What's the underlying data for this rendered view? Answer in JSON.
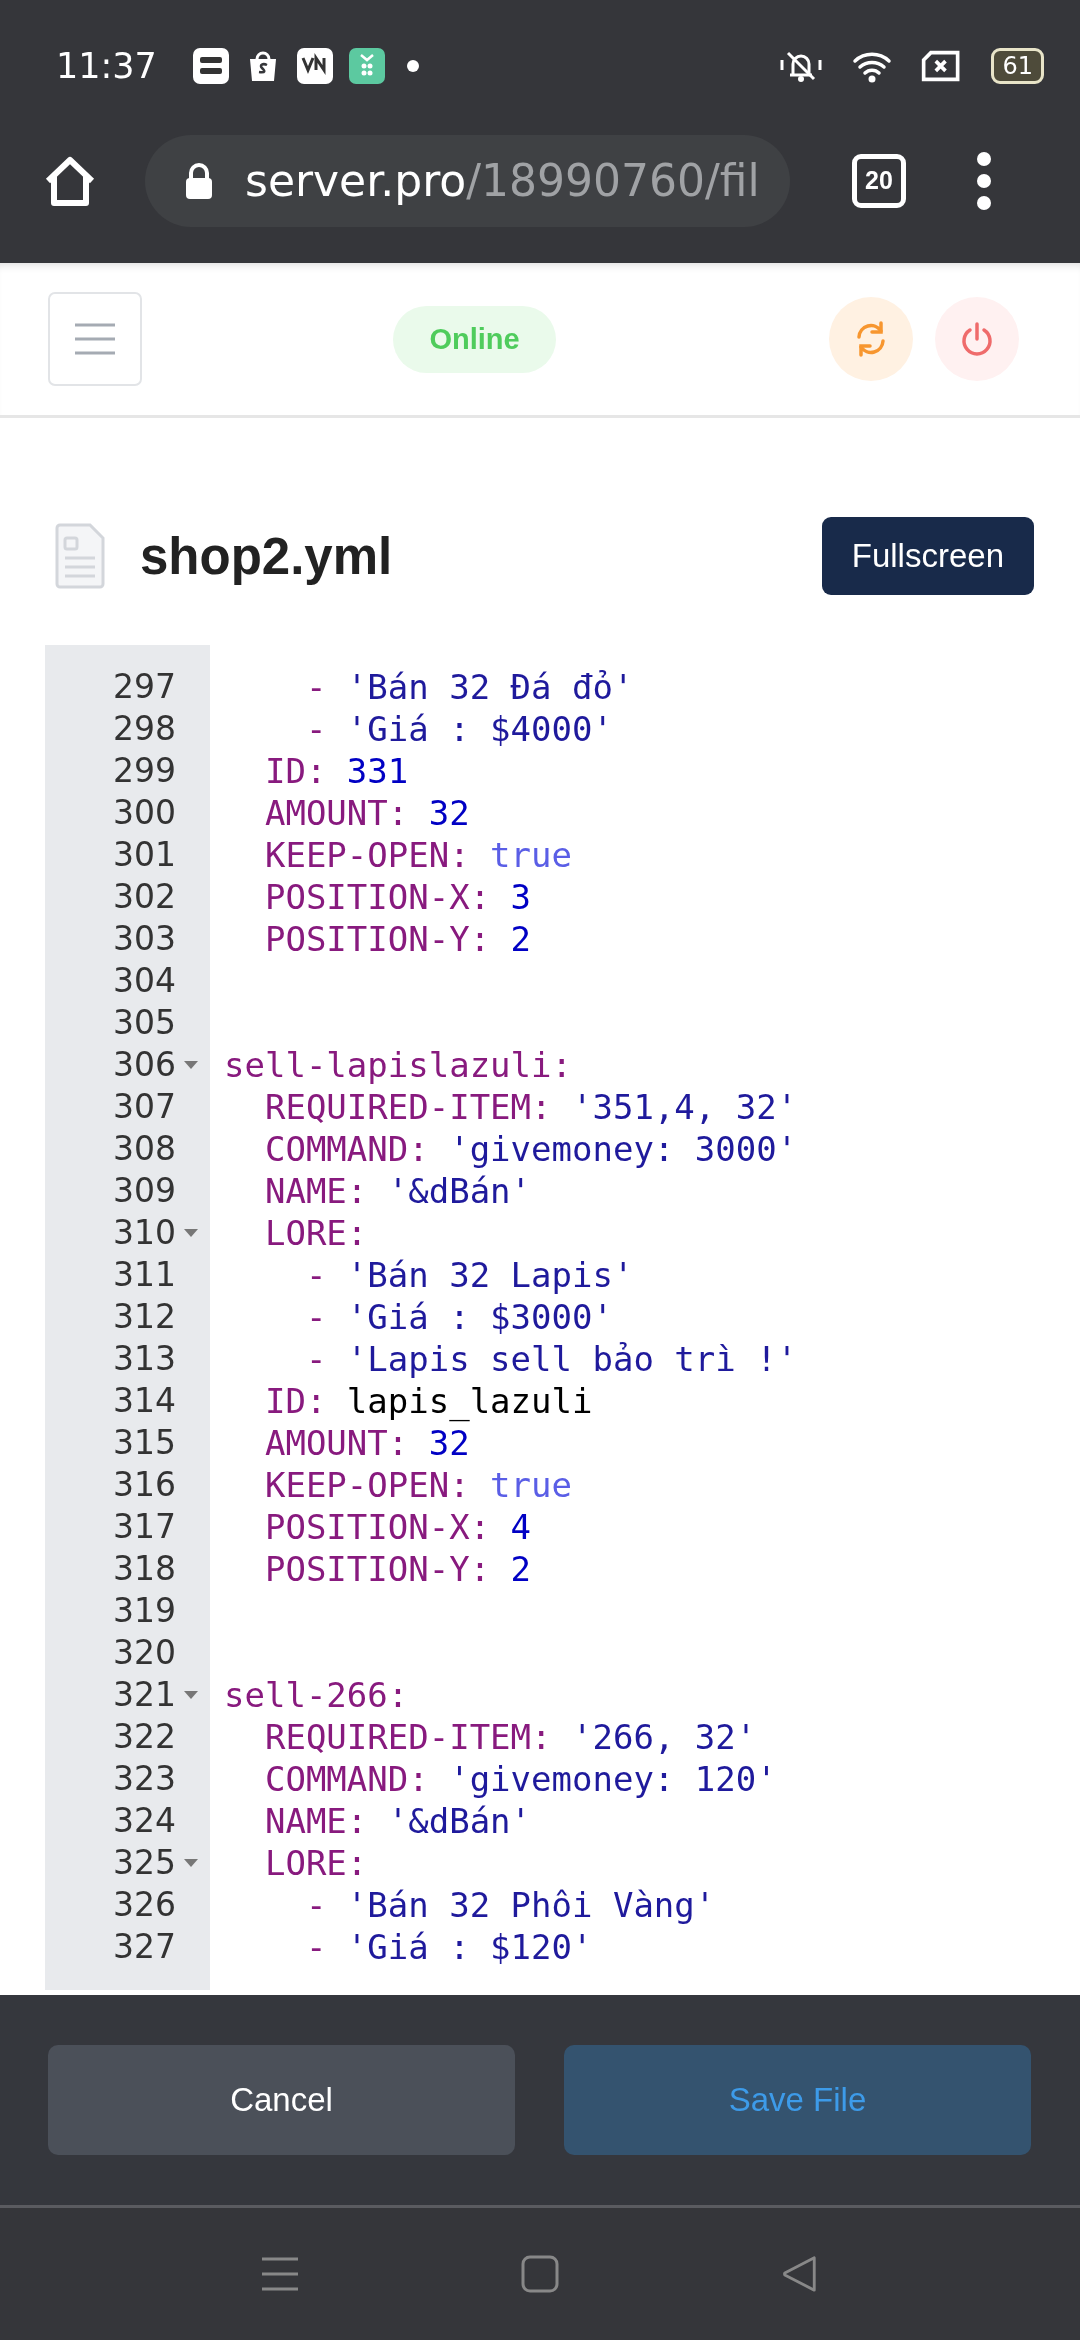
{
  "status_bar": {
    "time": "11:37",
    "battery": "61"
  },
  "browser": {
    "url_host": "server.pro",
    "url_path": "/18990760/fil",
    "tab_count": "20"
  },
  "header": {
    "status": "Online"
  },
  "file": {
    "name": "shop2.yml",
    "fullscreen_button": "Fullscreen"
  },
  "editor": {
    "lines": [
      {
        "number": "297",
        "fold": false,
        "tokens": [
          {
            "text": "    - ",
            "kind": "key"
          },
          {
            "text": "'Bán 32 Đá đỏ'",
            "kind": "string"
          }
        ]
      },
      {
        "number": "298",
        "fold": false,
        "tokens": [
          {
            "text": "    - ",
            "kind": "key"
          },
          {
            "text": "'Giá : $4000'",
            "kind": "string"
          }
        ]
      },
      {
        "number": "299",
        "fold": false,
        "tokens": [
          {
            "text": "  ID: ",
            "kind": "key"
          },
          {
            "text": "331",
            "kind": "number"
          }
        ]
      },
      {
        "number": "300",
        "fold": false,
        "tokens": [
          {
            "text": "  AMOUNT: ",
            "kind": "key"
          },
          {
            "text": "32",
            "kind": "number"
          }
        ]
      },
      {
        "number": "301",
        "fold": false,
        "tokens": [
          {
            "text": "  KEEP-OPEN: ",
            "kind": "key"
          },
          {
            "text": "true",
            "kind": "atom"
          }
        ]
      },
      {
        "number": "302",
        "fold": false,
        "tokens": [
          {
            "text": "  POSITION-X: ",
            "kind": "key"
          },
          {
            "text": "3",
            "kind": "number"
          }
        ]
      },
      {
        "number": "303",
        "fold": false,
        "tokens": [
          {
            "text": "  POSITION-Y: ",
            "kind": "key"
          },
          {
            "text": "2",
            "kind": "number"
          }
        ]
      },
      {
        "number": "304",
        "fold": false
      },
      {
        "number": "305",
        "fold": false
      },
      {
        "number": "306",
        "fold": true,
        "tokens": [
          {
            "text": "sell-lapislazuli:",
            "kind": "key"
          }
        ]
      },
      {
        "number": "307",
        "fold": false,
        "tokens": [
          {
            "text": "  REQUIRED-ITEM: ",
            "kind": "key"
          },
          {
            "text": "'351,4, 32'",
            "kind": "string"
          }
        ]
      },
      {
        "number": "308",
        "fold": false,
        "tokens": [
          {
            "text": "  COMMAND: ",
            "kind": "key"
          },
          {
            "text": "'givemoney: 3000'",
            "kind": "string"
          }
        ]
      },
      {
        "number": "309",
        "fold": false,
        "tokens": [
          {
            "text": "  NAME: ",
            "kind": "key"
          },
          {
            "text": "'&dBán'",
            "kind": "string"
          }
        ]
      },
      {
        "number": "310",
        "fold": true,
        "tokens": [
          {
            "text": "  LORE:",
            "kind": "key"
          }
        ]
      },
      {
        "number": "311",
        "fold": false,
        "tokens": [
          {
            "text": "    - ",
            "kind": "key"
          },
          {
            "text": "'Bán 32 Lapis'",
            "kind": "string"
          }
        ]
      },
      {
        "number": "312",
        "fold": false,
        "tokens": [
          {
            "text": "    - ",
            "kind": "key"
          },
          {
            "text": "'Giá : $3000'",
            "kind": "string"
          }
        ]
      },
      {
        "number": "313",
        "fold": false,
        "tokens": [
          {
            "text": "    - ",
            "kind": "key"
          },
          {
            "text": "'Lapis sell bảo trì !'",
            "kind": "string"
          }
        ]
      },
      {
        "number": "314",
        "fold": false,
        "tokens": [
          {
            "text": "  ID: ",
            "kind": "key"
          },
          {
            "text": "lapis_lazuli",
            "kind": "plain"
          }
        ]
      },
      {
        "number": "315",
        "fold": false,
        "tokens": [
          {
            "text": "  AMOUNT: ",
            "kind": "key"
          },
          {
            "text": "32",
            "kind": "number"
          }
        ]
      },
      {
        "number": "316",
        "fold": false,
        "tokens": [
          {
            "text": "  KEEP-OPEN: ",
            "kind": "key"
          },
          {
            "text": "true",
            "kind": "atom"
          }
        ]
      },
      {
        "number": "317",
        "fold": false,
        "tokens": [
          {
            "text": "  POSITION-X: ",
            "kind": "key"
          },
          {
            "text": "4",
            "kind": "number"
          }
        ]
      },
      {
        "number": "318",
        "fold": false,
        "tokens": [
          {
            "text": "  POSITION-Y: ",
            "kind": "key"
          },
          {
            "text": "2",
            "kind": "number"
          }
        ]
      },
      {
        "number": "319",
        "fold": false
      },
      {
        "number": "320",
        "fold": false
      },
      {
        "number": "321",
        "fold": true,
        "tokens": [
          {
            "text": "sell-266:",
            "kind": "key"
          }
        ]
      },
      {
        "number": "322",
        "fold": false,
        "tokens": [
          {
            "text": "  REQUIRED-ITEM: ",
            "kind": "key"
          },
          {
            "text": "'266, 32'",
            "kind": "string"
          }
        ]
      },
      {
        "number": "323",
        "fold": false,
        "tokens": [
          {
            "text": "  COMMAND: ",
            "kind": "key"
          },
          {
            "text": "'givemoney: 120'",
            "kind": "string"
          }
        ]
      },
      {
        "number": "324",
        "fold": false,
        "tokens": [
          {
            "text": "  NAME: ",
            "kind": "key"
          },
          {
            "text": "'&dBán'",
            "kind": "string"
          }
        ]
      },
      {
        "number": "325",
        "fold": true,
        "tokens": [
          {
            "text": "  LORE:",
            "kind": "key"
          }
        ]
      },
      {
        "number": "326",
        "fold": false,
        "tokens": [
          {
            "text": "    - ",
            "kind": "key"
          },
          {
            "text": "'Bán 32 Phôi Vàng'",
            "kind": "string"
          }
        ]
      },
      {
        "number": "327",
        "fold": false,
        "tokens": [
          {
            "text": "    - ",
            "kind": "key"
          },
          {
            "text": "'Giá : $120'",
            "kind": "string"
          }
        ]
      }
    ]
  },
  "actions": {
    "cancel": "Cancel",
    "save": "Save File"
  }
}
